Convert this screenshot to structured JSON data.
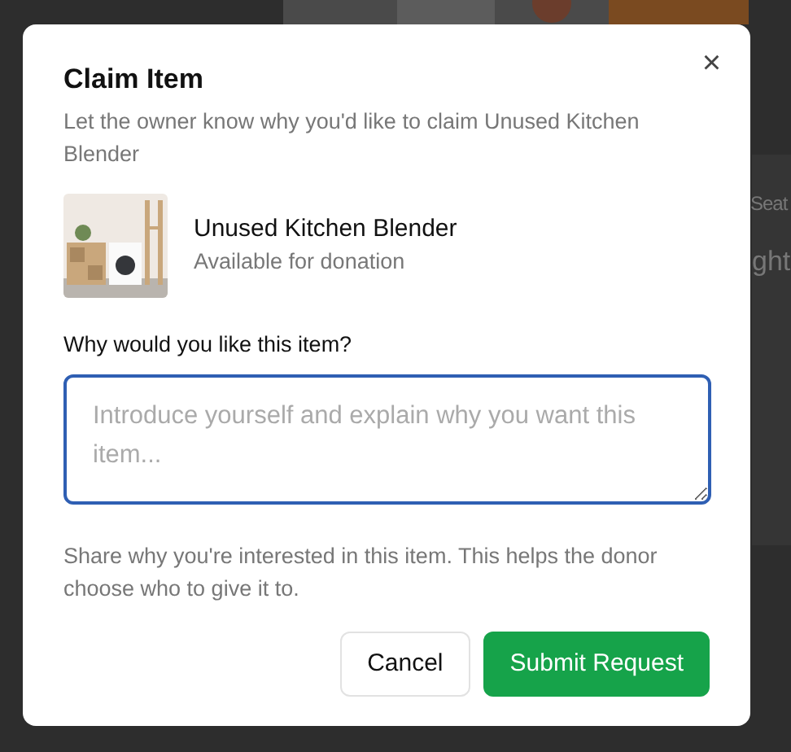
{
  "background": {
    "fragments": [
      "Seat",
      "ght"
    ]
  },
  "dialog": {
    "title": "Claim Item",
    "description": "Let the owner know why you'd like to claim Unused Kitchen Blender",
    "close": "×",
    "item": {
      "name": "Unused Kitchen Blender",
      "status": "Available for donation"
    },
    "field": {
      "label": "Why would you like this item?",
      "placeholder": "Introduce yourself and explain why you want this item...",
      "focused": true
    },
    "help": "Share why you're interested in this item. This helps the donor choose who to give it to.",
    "buttons": [
      {
        "label": "Cancel",
        "kind": "secondary"
      },
      {
        "label": "Submit Request",
        "kind": "primary"
      }
    ]
  }
}
